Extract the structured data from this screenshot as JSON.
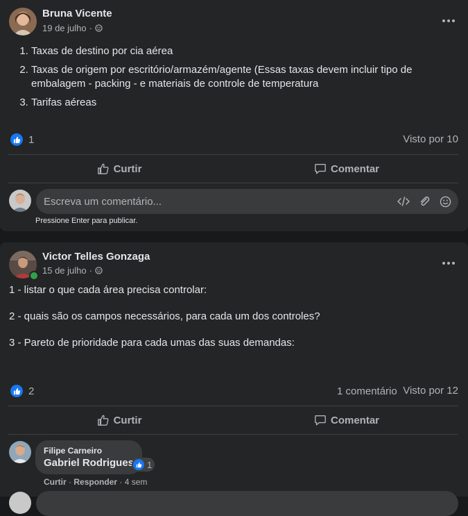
{
  "post1": {
    "author": "Bruna Vicente",
    "date": "19 de julho",
    "items": [
      "Taxas de destino por cia aérea",
      "Taxas de origem por escritório/armazém/agente (Essas taxas devem incluir tipo de embalagem - packing - e materiais de controle de temperatura",
      "Tarifas aéreas"
    ],
    "like_count": "1",
    "seen_by": "Visto por 10",
    "like_label": "Curtir",
    "comment_label": "Comentar",
    "comment_placeholder": "Escreva um comentário...",
    "enter_hint": "Pressione Enter para publicar."
  },
  "post2": {
    "author": "Victor Telles Gonzaga",
    "date": "15 de julho",
    "lines": [
      "1 - listar o que cada área precisa controlar:",
      "2 - quais são os campos necessários, para cada um dos controles?",
      "3 - Pareto de prioridade para cada umas das suas demandas:"
    ],
    "like_count": "2",
    "comments_count": "1 comentário",
    "seen_by": "Visto por 12",
    "like_label": "Curtir",
    "comment_label": "Comentar",
    "comment": {
      "author": "Filipe Carneiro",
      "text": "Gabriel Rodrigues",
      "reaction_count": "1",
      "like_action": "Curtir",
      "reply_action": "Responder",
      "age": "4 sem"
    }
  },
  "colors": {
    "background": "#18191a",
    "card": "#242526",
    "accent": "#1877f2",
    "online": "#31a24c"
  },
  "icons": [
    "globe-icon",
    "more-icon",
    "like-icon",
    "thumbs-up-outline-icon",
    "comment-outline-icon",
    "code-icon",
    "paperclip-icon",
    "emoji-icon"
  ]
}
